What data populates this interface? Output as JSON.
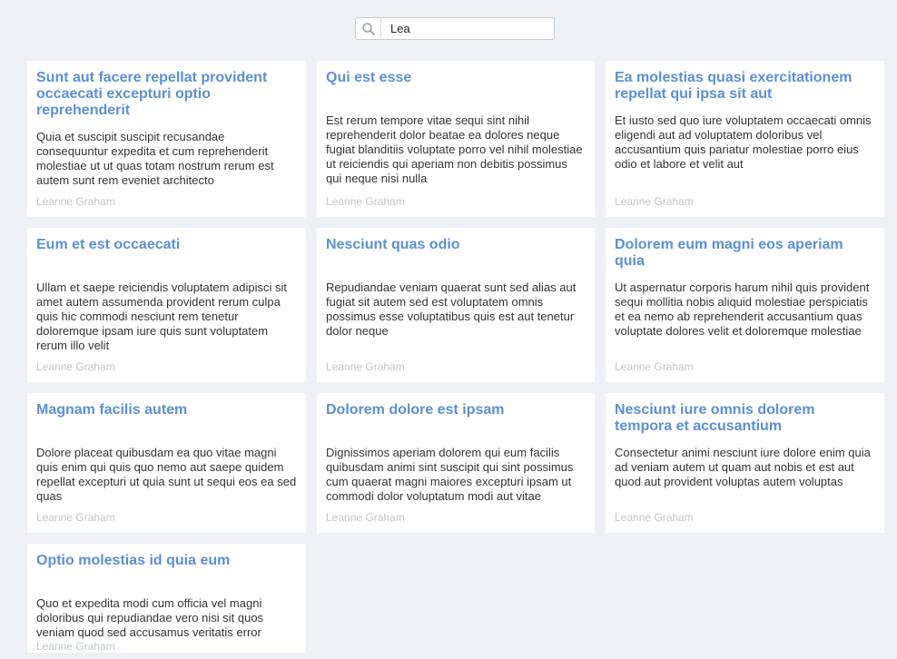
{
  "search": {
    "value": "Lea",
    "icon": "search-icon"
  },
  "rows": [
    {
      "height": 172,
      "cards": [
        {
          "title": "Sunt aut facere repellat provident occaecati excepturi optio reprehenderit",
          "body": "Quia et suscipit suscipit recusandae consequuntur expedita et cum reprehenderit molestiae ut ut quas totam nostrum rerum est autem sunt rem eveniet architecto",
          "author": "Leanne Graham"
        },
        {
          "title": "Qui est esse",
          "body": "Est rerum tempore vitae sequi sint nihil reprehenderit dolor beatae ea dolores neque fugiat blanditiis voluptate porro vel nihil molestiae ut reiciendis qui aperiam non debitis possimus qui neque nisi nulla",
          "author": "Leanne Graham"
        },
        {
          "title": "Ea molestias quasi exercitationem repellat qui ipsa sit aut",
          "body": "Et iusto sed quo iure voluptatem occaecati omnis eligendi aut ad voluptatem doloribus vel accusantium quis pariatur molestiae porro eius odio et labore et velit aut",
          "author": "Leanne Graham"
        }
      ]
    },
    {
      "height": 170,
      "cards": [
        {
          "title": "Eum et est occaecati",
          "body": "Ullam et saepe reiciendis voluptatem adipisci sit amet autem assumenda provident rerum culpa quis hic commodi nesciunt rem tenetur doloremque ipsam iure quis sunt voluptatem rerum illo velit",
          "author": "Leanne Graham"
        },
        {
          "title": "Nesciunt quas odio",
          "body": "Repudiandae veniam quaerat sunt sed alias aut fugiat sit autem sed est voluptatem omnis possimus esse voluptatibus quis est aut tenetur dolor neque",
          "author": "Leanne Graham"
        },
        {
          "title": "Dolorem eum magni eos aperiam quia",
          "body": "Ut aspernatur corporis harum nihil quis provident sequi mollitia nobis aliquid molestiae perspiciatis et ea nemo ab reprehenderit accusantium quas voluptate dolores velit et doloremque molestiae",
          "author": "Leanne Graham"
        }
      ]
    },
    {
      "height": 154,
      "cards": [
        {
          "title": "Magnam facilis autem",
          "body": "Dolore placeat quibusdam ea quo vitae magni quis enim qui quis quo nemo aut saepe quidem repellat excepturi ut quia sunt ut sequi eos ea sed quas",
          "author": "Leanne Graham"
        },
        {
          "title": "Dolorem dolore est ipsam",
          "body": "Dignissimos aperiam dolorem qui eum facilis quibusdam animi sint suscipit qui sint possimus cum quaerat magni maiores excepturi ipsam ut commodi dolor voluptatum modi aut vitae",
          "author": "Leanne Graham"
        },
        {
          "title": "Nesciunt iure omnis dolorem tempora et accusantium",
          "body": "Consectetur animi nesciunt iure dolore enim quia ad veniam autem ut quam aut nobis et est aut quod aut provident voluptas autem voluptas",
          "author": "Leanne Graham"
        }
      ]
    },
    {
      "height": 120,
      "cards": [
        {
          "title": "Optio molestias id quia eum",
          "body": "Quo et expedita modi cum officia vel magni doloribus qui repudiandae vero nisi sit quos veniam quod sed accusamus veritatis error",
          "author": "Leanne Graham"
        }
      ]
    }
  ]
}
